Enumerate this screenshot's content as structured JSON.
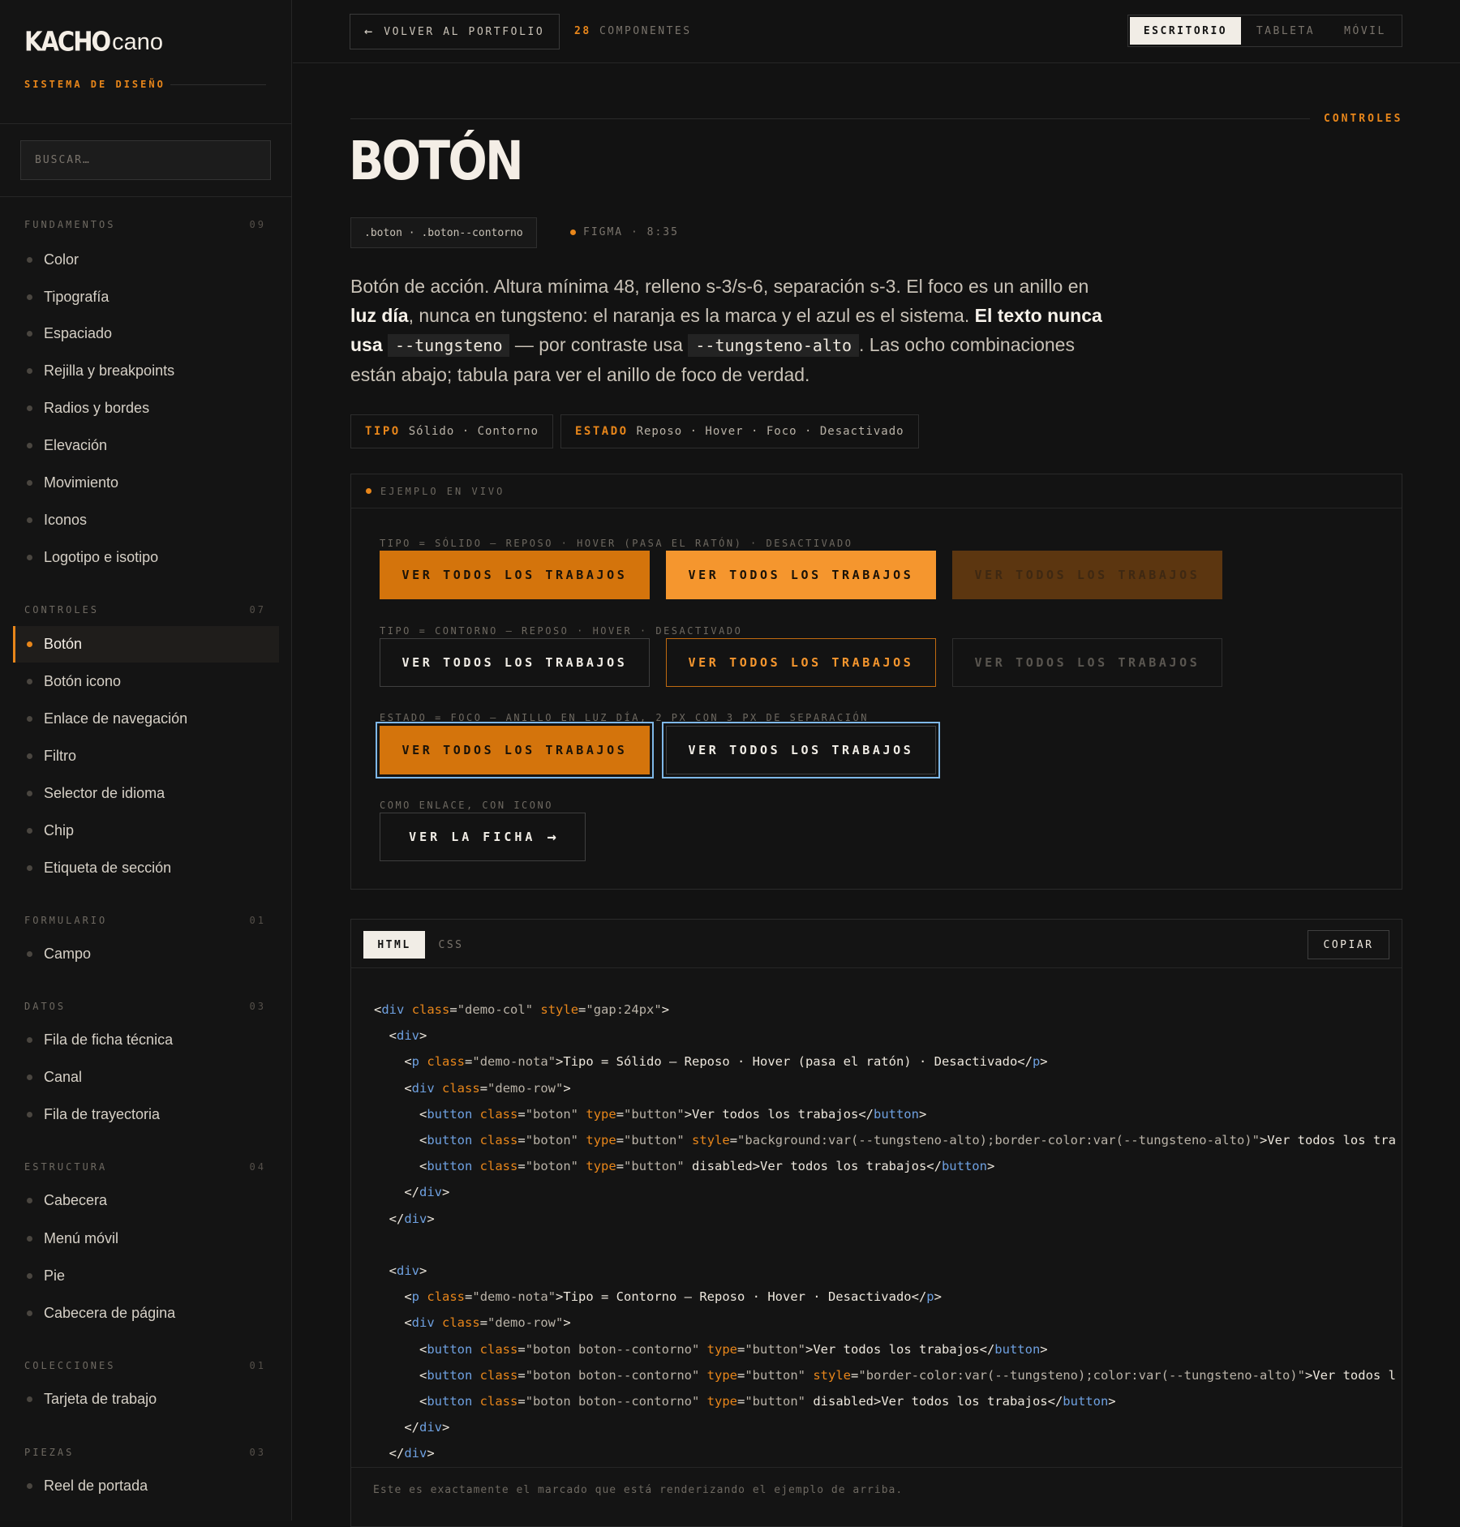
{
  "brand": {
    "logo_strong": "KACHO",
    "logo_light": "cano",
    "system_label": "SISTEMA DE DISEÑO"
  },
  "search": {
    "placeholder": "BUSCAR…"
  },
  "nav": {
    "sections": [
      {
        "title": "FUNDAMENTOS",
        "count": "09"
      },
      {
        "title": "CONTROLES",
        "count": "07"
      },
      {
        "title": "FORMULARIO",
        "count": "01"
      },
      {
        "title": "DATOS",
        "count": "03"
      },
      {
        "title": "ESTRUCTURA",
        "count": "04"
      },
      {
        "title": "COLECCIONES",
        "count": "01"
      },
      {
        "title": "PIEZAS",
        "count": "03"
      }
    ],
    "items": [
      "Color",
      "Tipografía",
      "Espaciado",
      "Rejilla y breakpoints",
      "Radios y bordes",
      "Elevación",
      "Movimiento",
      "Iconos",
      "Logotipo e isotipo",
      "Botón",
      "Botón icono",
      "Enlace de navegación",
      "Filtro",
      "Selector de idioma",
      "Chip",
      "Etiqueta de sección",
      "Campo",
      "Fila de ficha técnica",
      "Canal",
      "Fila de trayectoria",
      "Cabecera",
      "Menú móvil",
      "Pie",
      "Cabecera de página",
      "Tarjeta de trabajo",
      "Reel de portada"
    ],
    "active_item": "Botón"
  },
  "topbar": {
    "back_label": "VOLVER AL PORTFOLIO",
    "count_num": "28",
    "count_label": "COMPONENTES",
    "viewports": [
      "ESCRITORIO",
      "TABLETA",
      "MÓVIL"
    ],
    "active_viewport": "ESCRITORIO"
  },
  "page": {
    "crumb": "CONTROLES",
    "title": "BOTÓN",
    "classes": ".boton · .boton--contorno",
    "figma": "FIGMA · 8:35",
    "desc": {
      "p1": "Botón de acción. Altura mínima 48, relleno s-3/s-6, separación s-3. El foco es un anillo en ",
      "b1": "luz día",
      "p2": ", nunca en tungsteno: el naranja es la marca y el azul es el sistema. ",
      "b2": "El texto nunca usa",
      "c1": "--tungsteno",
      "p3": " — por contraste usa ",
      "c2": "--tungsteno-alto",
      "p4": ". Las ocho combinaciones están abajo; tabula para ver el anillo de foco de verdad."
    },
    "props": [
      {
        "key": "TIPO",
        "value": "Sólido · Contorno"
      },
      {
        "key": "ESTADO",
        "value": "Reposo · Hover · Foco · Desactivado"
      }
    ]
  },
  "live": {
    "header": "EJEMPLO EN VIVO",
    "notes": [
      "Tipo = Sólido — Reposo · Hover (pasa el ratón) · Desactivado",
      "Tipo = Contorno — Reposo · Hover · Desactivado",
      "Estado = Foco — anillo en luz día, 2 px con 3 px de separación",
      "Como enlace, con icono"
    ],
    "button_label": "VER TODOS LOS TRABAJOS",
    "link_label": "VER LA FICHA",
    "colors": {
      "brand": "#D4740C",
      "brand_hover": "#F5962E",
      "focus_ring": "#7FB8E8"
    }
  },
  "code": {
    "tabs": [
      "HTML",
      "CSS"
    ],
    "active_tab": "HTML",
    "copy_label": "COPIAR",
    "lines": [
      "<div class=\"demo-col\" style=\"gap:24px\">",
      "  <div>",
      "    <p class=\"demo-nota\">Tipo = Sólido — Reposo · Hover (pasa el ratón) · Desactivado</p>",
      "    <div class=\"demo-row\">",
      "      <button class=\"boton\" type=\"button\">Ver todos los trabajos</button>",
      "      <button class=\"boton\" type=\"button\" style=\"background:var(--tungsteno-alto);border-color:var(--tungsteno-alto)\">Ver todos los tra",
      "      <button class=\"boton\" type=\"button\" disabled>Ver todos los trabajos</button>",
      "    </div>",
      "  </div>",
      "",
      "  <div>",
      "    <p class=\"demo-nota\">Tipo = Contorno — Reposo · Hover · Desactivado</p>",
      "    <div class=\"demo-row\">",
      "      <button class=\"boton boton--contorno\" type=\"button\">Ver todos los trabajos</button>",
      "      <button class=\"boton boton--contorno\" type=\"button\" style=\"border-color:var(--tungsteno);color:var(--tungsteno-alto)\">Ver todos l",
      "      <button class=\"boton boton--contorno\" type=\"button\" disabled>Ver todos los trabajos</button>",
      "    </div>",
      "  </div>"
    ],
    "footer": "Este es exactamente el marcado que está renderizando el ejemplo de arriba."
  }
}
